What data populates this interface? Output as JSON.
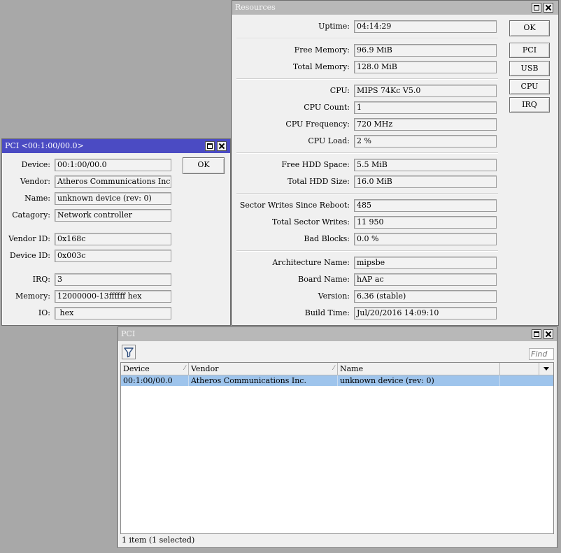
{
  "resources": {
    "title": "Resources",
    "fields": [
      {
        "label": "Uptime:",
        "value": "04:14:29"
      },
      {
        "label": "Free Memory:",
        "value": "96.9 MiB"
      },
      {
        "label": "Total Memory:",
        "value": "128.0 MiB"
      },
      {
        "label": "CPU:",
        "value": "MIPS 74Kc V5.0"
      },
      {
        "label": "CPU Count:",
        "value": "1"
      },
      {
        "label": "CPU Frequency:",
        "value": "720 MHz"
      },
      {
        "label": "CPU Load:",
        "value": "2 %"
      },
      {
        "label": "Free HDD Space:",
        "value": "5.5 MiB"
      },
      {
        "label": "Total HDD Size:",
        "value": "16.0 MiB"
      },
      {
        "label": "Sector Writes Since Reboot:",
        "value": "485"
      },
      {
        "label": "Total Sector Writes:",
        "value": "11 950"
      },
      {
        "label": "Bad Blocks:",
        "value": "0.0 %"
      },
      {
        "label": "Architecture Name:",
        "value": "mipsbe"
      },
      {
        "label": "Board Name:",
        "value": "hAP ac"
      },
      {
        "label": "Version:",
        "value": "6.36 (stable)"
      },
      {
        "label": "Build Time:",
        "value": "Jul/20/2016 14:09:10"
      }
    ],
    "buttons": {
      "ok": "OK",
      "pci": "PCI",
      "usb": "USB",
      "cpu": "CPU",
      "irq": "IRQ"
    }
  },
  "pci_detail": {
    "title": "PCI <00:1:00/00.0>",
    "ok": "OK",
    "fields": [
      {
        "label": "Device:",
        "value": "00:1:00/00.0"
      },
      {
        "label": "Vendor:",
        "value": "Atheros Communications Inc."
      },
      {
        "label": "Name:",
        "value": "unknown device (rev: 0)"
      },
      {
        "label": "Catagory:",
        "value": "Network controller"
      },
      {
        "label": "Vendor ID:",
        "value": "0x168c"
      },
      {
        "label": "Device ID:",
        "value": "0x003c"
      },
      {
        "label": "IRQ:",
        "value": "3"
      },
      {
        "label": "Memory:",
        "value": "12000000-13ffffff hex"
      },
      {
        "label": "IO:",
        "value": " hex"
      }
    ]
  },
  "pci_list": {
    "title": "PCI",
    "find_placeholder": "Find",
    "columns": [
      "Device",
      "Vendor",
      "Name"
    ],
    "rows": [
      {
        "device": "00:1:00/00.0",
        "vendor": "Atheros Communications Inc.",
        "name": "unknown device (rev: 0)"
      }
    ],
    "status": "1 item (1 selected)"
  },
  "colors": {
    "active_title": "#4b4bc3",
    "inactive_title": "#b8b8b8",
    "selected_row": "#9ec4ec",
    "desktop": "#a8a8a8"
  }
}
